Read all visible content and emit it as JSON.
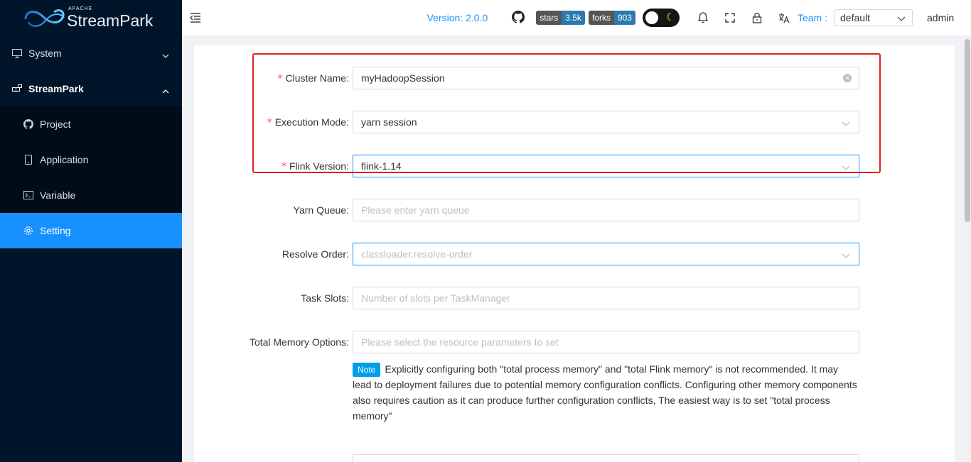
{
  "brand": {
    "apache": "APACHE",
    "name": "StreamPark"
  },
  "sidebar": {
    "items": [
      {
        "label": "System"
      },
      {
        "label": "StreamPark"
      }
    ],
    "sub_items": [
      {
        "label": "Project"
      },
      {
        "label": "Application"
      },
      {
        "label": "Variable"
      },
      {
        "label": "Setting"
      }
    ]
  },
  "header": {
    "version": "Version: 2.0.0",
    "stars_label": "stars",
    "stars_value": "3.5k",
    "forks_label": "forks",
    "forks_value": "903",
    "team_label": "Team :",
    "team_value": "default",
    "user": "admin"
  },
  "form": {
    "cluster_name": {
      "label": "Cluster Name",
      "value": "myHadoopSession"
    },
    "execution_mode": {
      "label": "Execution Mode",
      "value": "yarn session"
    },
    "flink_version": {
      "label": "Flink Version",
      "value": "flink-1.14"
    },
    "yarn_queue": {
      "label": "Yarn Queue",
      "placeholder": "Please enter yarn queue"
    },
    "resolve_order": {
      "label": "Resolve Order",
      "placeholder": "classloader.resolve-order"
    },
    "task_slots": {
      "label": "Task Slots",
      "placeholder": "Number of slots per TaskManager"
    },
    "total_memory": {
      "label": "Total Memory Options",
      "placeholder": "Please select the resource parameters to set"
    },
    "note_tag": "Note",
    "note_text": "Explicitly configuring both \"total process memory\" and \"total Flink memory\" is not recommended. It may lead to deployment failures due to potential memory configuration conflicts. Configuring other memory components also requires caution as it can produce further configuration conflicts, The easiest way is to set \"total process memory\""
  },
  "colors": {
    "accent": "#1890ff",
    "sidebar_bg": "#001529",
    "highlight_box": "#e02020"
  }
}
